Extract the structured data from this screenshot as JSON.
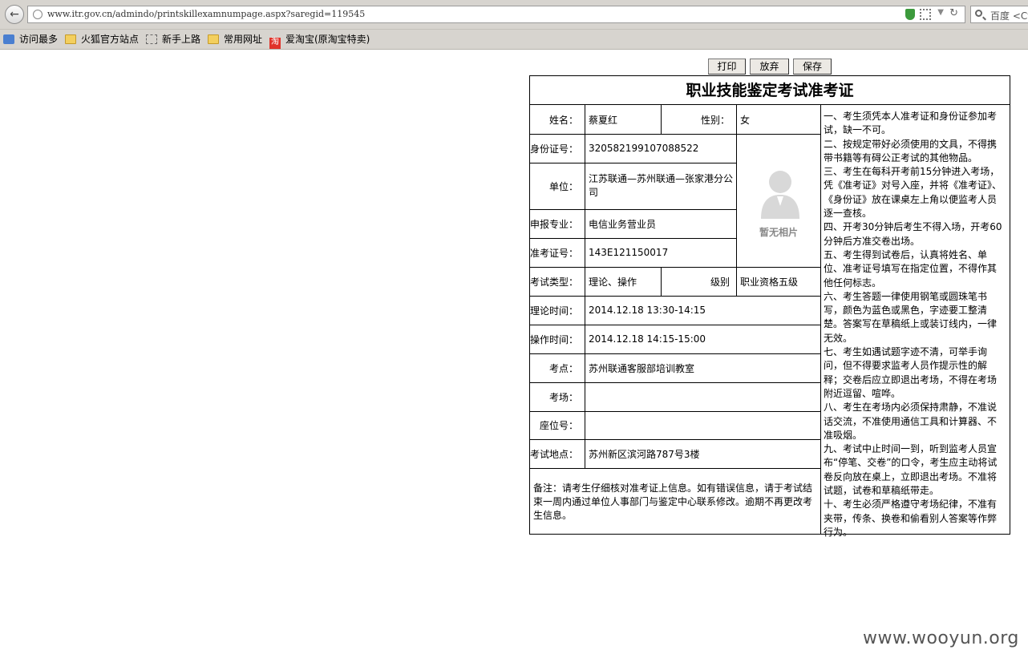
{
  "browser": {
    "url": "www.itr.gov.cn/admindo/printskillexamnumpage.aspx?saregid=119545",
    "search_placeholder": "百度 <Ct",
    "bookmarks": [
      "访问最多",
      "火狐官方站点",
      "新手上路",
      "常用网址",
      "爱淘宝(原淘宝特卖)"
    ]
  },
  "toolbar": {
    "print_label": "打印",
    "discard_label": "放弃",
    "save_label": "保存"
  },
  "card": {
    "title": "职业技能鉴定考试准考证",
    "labels": {
      "name": "姓名：",
      "gender": "性别：",
      "id_number": "身份证号：",
      "employer": "单位：",
      "major": "申报专业：",
      "ticket_number": "准考证号：",
      "exam_type": "考试类型：",
      "level": "级别",
      "theory_time": "理论时间：",
      "practice_time": "操作时间：",
      "exam_site": "考点：",
      "exam_room": "考场：",
      "seat_number": "座位号：",
      "exam_address": "考试地点："
    },
    "values": {
      "name": "蔡夏红",
      "gender": "女",
      "id_number": "320582199107088522",
      "employer": "江苏联通—苏州联通—张家港分公司",
      "major": "电信业务营业员",
      "ticket_number": "143E121150017",
      "exam_type": "理论、操作",
      "level": "职业资格五级",
      "theory_time": "2014.12.18 13:30-14:15",
      "practice_time": "2014.12.18 14:15-15:00",
      "exam_site": "苏州联通客服部培训教室",
      "exam_room": "",
      "seat_number": "",
      "exam_address": "苏州新区滨河路787号3楼"
    },
    "photo_placeholder": "暂无相片",
    "note": "备注：请考生仔细核对准考证上信息。如有错误信息，请于考试结束一周内通过单位人事部门与鉴定中心联系修改。逾期不再更改考生信息。",
    "rules": [
      "一、考生须凭本人准考证和身份证参加考试，缺一不可。",
      "二、按规定带好必须使用的文具，不得携带书籍等有碍公正考试的其他物品。",
      "三、考生在每科开考前15分钟进入考场，凭《准考证》对号入座，并将《准考证》、《身份证》放在课桌左上角以便监考人员逐一查核。",
      "四、开考30分钟后考生不得入场，开考60分钟后方准交卷出场。",
      "五、考生得到试卷后，认真将姓名、单位、准考证号填写在指定位置，不得作其他任何标志。",
      "六、考生答题一律使用钢笔或圆珠笔书写，颜色为蓝色或黑色，字迹要工整清楚。答案写在草稿纸上或装订线内，一律无效。",
      "七、考生如遇试题字迹不清，可举手询问，但不得要求监考人员作提示性的解释；交卷后应立即退出考场，不得在考场附近逗留、喧哗。",
      "八、考生在考场内必须保持肃静，不准说话交流，不准使用通信工具和计算器、不准吸烟。",
      "九、考试中止时间一到，听到监考人员宣布“停笔、交卷”的口令，考生应主动将试卷反向放在桌上，立即退出考场。不准将试题，试卷和草稿纸带走。",
      "十、考生必须严格遵守考场纪律，不准有夹带，传条、换卷和偷看别人答案等作弊行为。"
    ]
  },
  "watermark": "www.wooyun.org"
}
